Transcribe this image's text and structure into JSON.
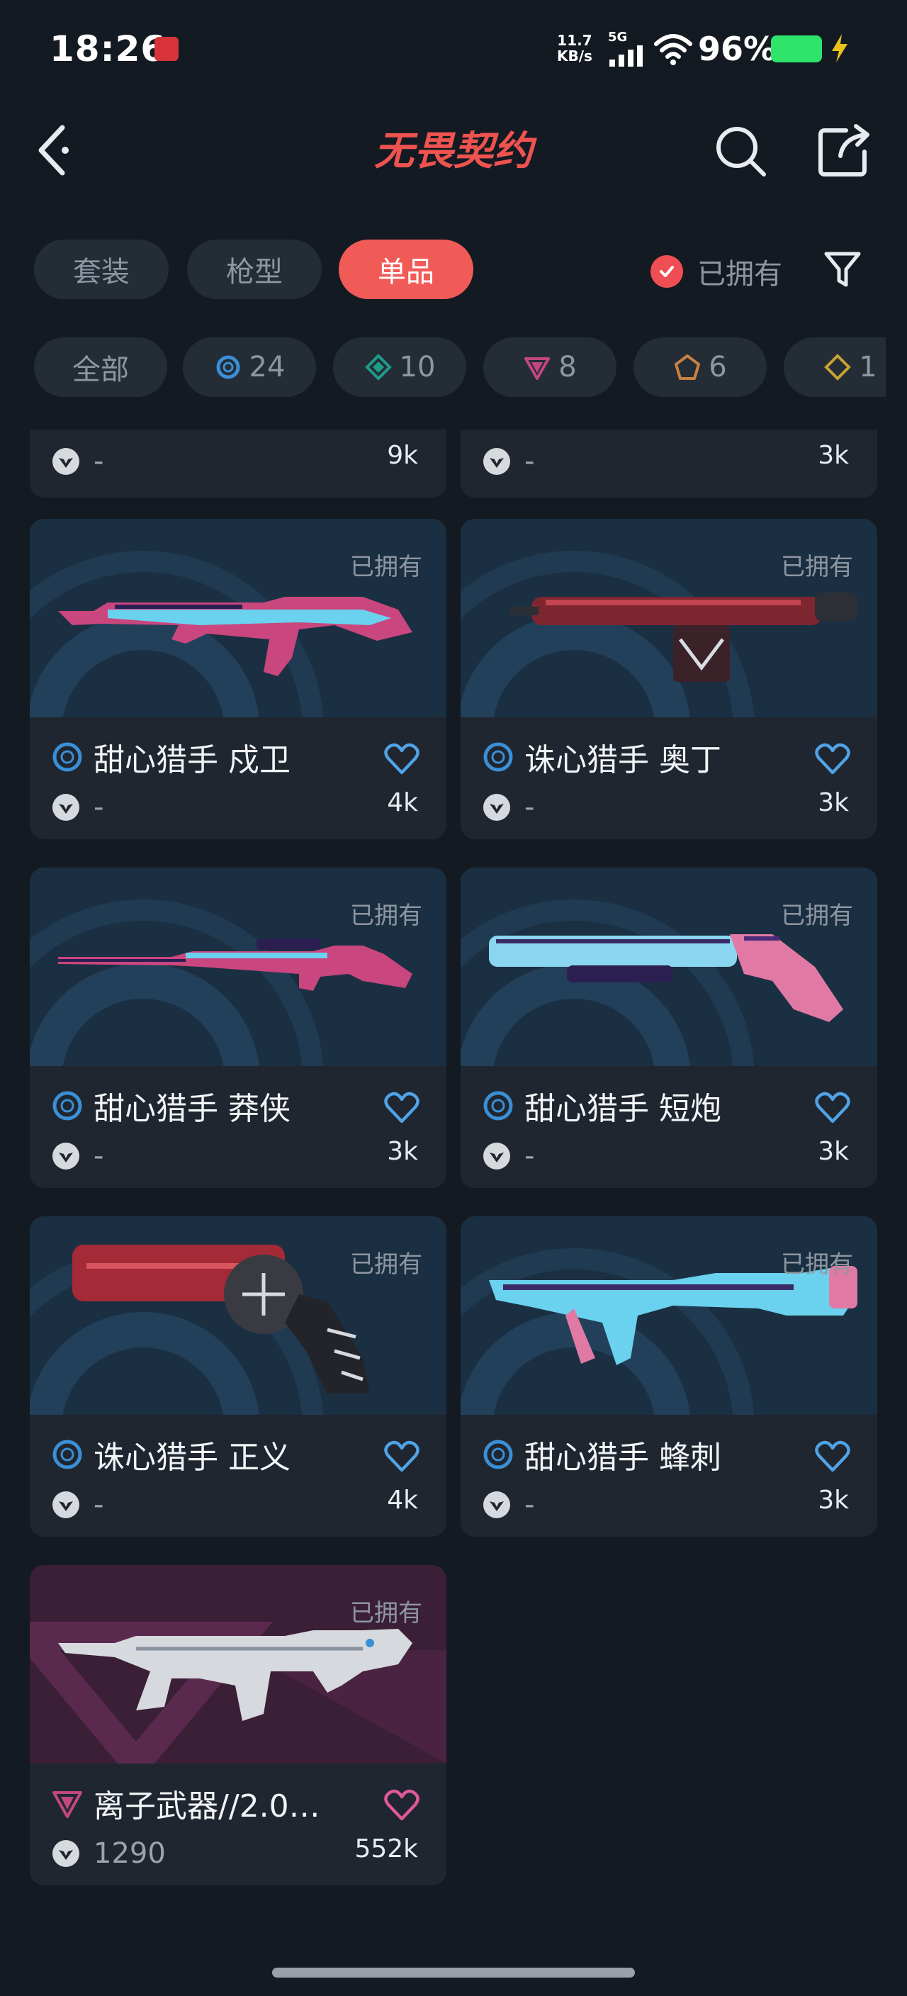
{
  "status": {
    "time": "18:26",
    "net_speed_value": "11.7",
    "net_speed_unit": "KB/s",
    "network_type": "5G",
    "battery_percent": "96%",
    "battery_level": 0.96
  },
  "header": {
    "title": "无畏契约"
  },
  "tabs": [
    "套装",
    "枪型",
    "单品"
  ],
  "active_tab": "单品",
  "owned_filter": {
    "label": "已拥有",
    "checked": true
  },
  "chips": [
    {
      "label": "全部",
      "icon": "all"
    },
    {
      "label": "24",
      "icon": "select-tier-icon",
      "color": "#3a8fd6"
    },
    {
      "label": "10",
      "icon": "deluxe-tier-icon",
      "color": "#1d9c8a"
    },
    {
      "label": "8",
      "icon": "premium-tier-icon",
      "color": "#c2477f"
    },
    {
      "label": "6",
      "icon": "exclusive-tier-icon",
      "color": "#c9813f"
    },
    {
      "label": "1",
      "icon": "ultra-tier-icon",
      "color": "#c7a233"
    }
  ],
  "partial_row": [
    {
      "price": "-",
      "likes": "9k"
    },
    {
      "price": "-",
      "likes": "3k"
    }
  ],
  "cards": [
    {
      "name": "甜心猎手 戍卫",
      "owned": "已拥有",
      "price": "-",
      "likes": "4k",
      "tier": "select",
      "theme": "blue",
      "weapon": "rifle-pink"
    },
    {
      "name": "诛心猎手 奥丁",
      "owned": "已拥有",
      "price": "-",
      "likes": "3k",
      "tier": "select",
      "theme": "blue",
      "weapon": "heavy-red"
    },
    {
      "name": "甜心猎手 莽侠",
      "owned": "已拥有",
      "price": "-",
      "likes": "3k",
      "tier": "select",
      "theme": "blue",
      "weapon": "sniper-pink"
    },
    {
      "name": "甜心猎手 短炮",
      "owned": "已拥有",
      "price": "-",
      "likes": "3k",
      "tier": "select",
      "theme": "blue",
      "weapon": "shotgun-pink"
    },
    {
      "name": "诛心猎手 正义",
      "owned": "已拥有",
      "price": "-",
      "likes": "4k",
      "tier": "select",
      "theme": "blue",
      "weapon": "revolver-red"
    },
    {
      "name": "甜心猎手 蜂刺",
      "owned": "已拥有",
      "price": "-",
      "likes": "3k",
      "tier": "select",
      "theme": "blue",
      "weapon": "smg-pink"
    },
    {
      "name": "离子武器//2.0…",
      "owned": "已拥有",
      "price": "1290",
      "likes": "552k",
      "tier": "premium",
      "theme": "magenta",
      "weapon": "rifle-white"
    }
  ],
  "colors": {
    "background": "#141a22",
    "card": "#1f262f",
    "accent": "#f05b57",
    "select_tier": "#3a8fd6",
    "premium_tier": "#c2477f"
  }
}
